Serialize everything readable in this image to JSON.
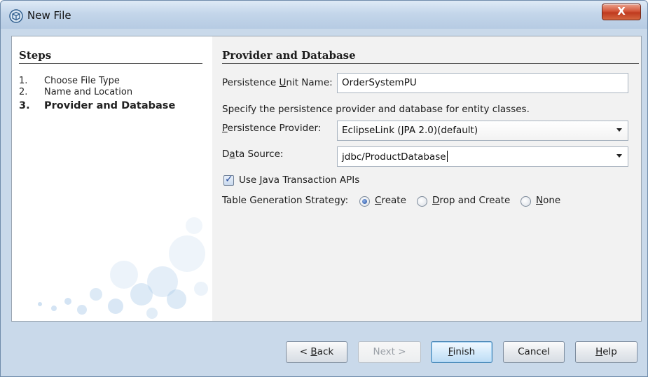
{
  "window": {
    "title": "New File",
    "close_label": "X"
  },
  "steps": {
    "heading": "Steps",
    "items": [
      {
        "num": "1.",
        "label": "Choose File Type"
      },
      {
        "num": "2.",
        "label": "Name and Location"
      },
      {
        "num": "3.",
        "label": "Provider and Database"
      }
    ]
  },
  "form": {
    "heading": "Provider and Database",
    "unit_name_label_pre": "Persistence ",
    "unit_name_label_u": "U",
    "unit_name_label_post": "nit Name:",
    "unit_name_value": "OrderSystemPU",
    "description": "Specify the persistence provider and database for entity classes.",
    "provider_label_u": "P",
    "provider_label_post": "ersistence Provider:",
    "provider_value": "EclipseLink (JPA 2.0)(default)",
    "datasource_label_pre": "D",
    "datasource_label_u": "a",
    "datasource_label_post": "ta Source:",
    "datasource_value": "jdbc/ProductDatabase",
    "jta_label_pre": "Use ",
    "jta_label_u": "J",
    "jta_label_post": "ava Transaction APIs",
    "jta_checked": true,
    "strategy_label": "Table Generation Strategy:",
    "strategy_create_u": "C",
    "strategy_create_post": "reate",
    "strategy_drop_u": "D",
    "strategy_drop_post": "rop and Create",
    "strategy_none_u": "N",
    "strategy_none_post": "one",
    "strategy_selected": "Create"
  },
  "buttons": {
    "back_pre": "< ",
    "back_u": "B",
    "back_post": "ack",
    "next": "Next >",
    "finish_u": "F",
    "finish_post": "inish",
    "cancel": "Cancel",
    "help_u": "H",
    "help_post": "elp"
  },
  "colors": {
    "frame": "#c9d9ea",
    "close": "#d4573b",
    "default_button": "#bddcf5"
  }
}
